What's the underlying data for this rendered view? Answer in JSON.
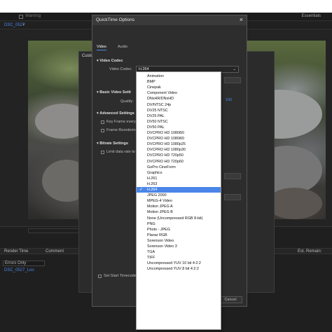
{
  "app": {
    "top_label": "Warning",
    "workspace": "Essentials",
    "sequence_tab": "DSC_0527",
    "sequence_close": "×"
  },
  "timeline": {
    "col_render_time": "Render Time",
    "col_comment": "Comment",
    "col_est_remain": "Est. Remain:",
    "filter_value": "Errors Only",
    "file_item": "DSC_0527_Loo"
  },
  "export_dialog": {
    "title_fragment": "Custo"
  },
  "quicktime_dialog": {
    "title": "QuickTime Options",
    "close_glyph": "×",
    "tabs": [
      "Video",
      "Audio"
    ],
    "active_tab": "Video",
    "video_codec_section": "Video Codec",
    "video_codec_label": "Video Codec:",
    "video_codec_value": "H.264",
    "basic_settings_section": "Basic Video Setti",
    "quality_label": "Quality:",
    "advanced_settings_section": "Advanced Settings",
    "key_frame_label": "Key Frame every",
    "frame_reordering_label": "Frame Reordering",
    "bitrate_settings_section": "Bitrate Settings",
    "limit_data_rate_label": "Limit data rate to",
    "set_start_timecode_label": "Set Start Timecode",
    "cancel_label": "Cancel",
    "side_number": "100"
  },
  "codec_options": [
    "Animation",
    "BMP",
    "Cinepak",
    "Component Video",
    "DNxHR/DNxHD",
    "DV/NTSC 24p",
    "DV25 NTSC",
    "DV25 PAL",
    "DV50 NTSC",
    "DV50 PAL",
    "DVCPRO HD 1080i50",
    "DVCPRO HD 1080i60",
    "DVCPRO HD 1080p25",
    "DVCPRO HD 1080p30",
    "DVCPRO HD 720p50",
    "DVCPRO HD 720p60",
    "GoPro CineForm",
    "Graphics",
    "H.261",
    "H.263",
    "H.264",
    "JPEG 2000",
    "MPEG-4 Video",
    "Motion JPEG A",
    "Motion JPEG B",
    "None (Uncompressed RGB 8-bit)",
    "PNG",
    "Photo - JPEG",
    "Planar RGB",
    "Sorenson Video",
    "Sorenson Video 3",
    "TGA",
    "TIFF",
    "Uncompressed YUV 10 bit 4:2:2",
    "Uncompressed YUV 8 bit 4:2:2"
  ],
  "selected_codec": "H.264",
  "colors": {
    "selection": "#4a86e8",
    "dialog_bg": "#2d2d2d",
    "app_bg": "#232323"
  }
}
